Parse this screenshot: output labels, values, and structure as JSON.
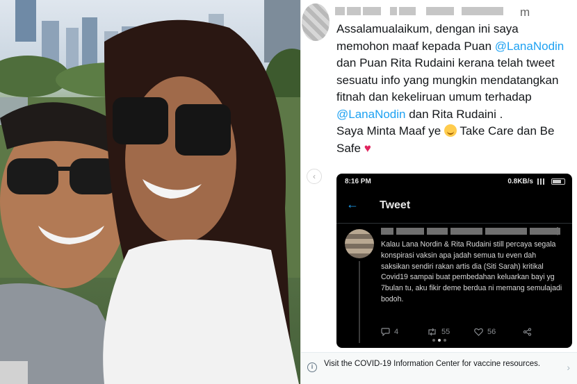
{
  "tweet": {
    "handle_tail": "m",
    "text": {
      "line1": "Assalamualaikum, dengan ini saya memohon maaf kepada Puan ",
      "mention1": "@LanaNodin",
      "line2": " dan Puan Rita Rudaini kerana telah tweet sesuatu info yang mungkin mendatangkan fitnah dan kekeliruan umum terhadap ",
      "mention2": "@LanaNodin",
      "line3": " dan Rita Rudaini .",
      "line4a": "Saya Minta Maaf ye ",
      "line4b": " Take Care dan Be Safe ",
      "heart": "♥"
    },
    "carousel_prev": "‹"
  },
  "phone": {
    "status_time": "8:16 PM",
    "status_speed": "0.8KB/s",
    "back_icon": "←",
    "app_title": "Tweet",
    "menu_icon": "⋮",
    "inner_tweet_text": "Kalau Lana Nordin & Rita Rudaini still percaya segala konspirasi vaksin apa jadah semua tu even dah saksikan sendiri rakan artis dia (Siti Sarah) kritikal Covid19 sampai buat pembedahan keluarkan bayi yg 7bulan tu, aku fikir deme berdua ni memang semulajadi bodoh.",
    "actions": {
      "replies": "4",
      "retweets": "55",
      "likes": "56"
    }
  },
  "covid_banner": {
    "text": "Visit the COVID-19 Information Center for vaccine resources.",
    "info_glyph": "i",
    "chevron": "›"
  },
  "colors": {
    "accent": "#1da1f2",
    "heart": "#e0245e",
    "text": "#14171a"
  },
  "icons": [
    "reply-icon",
    "retweet-icon",
    "like-icon",
    "share-icon",
    "info-icon",
    "back-arrow-icon"
  ]
}
